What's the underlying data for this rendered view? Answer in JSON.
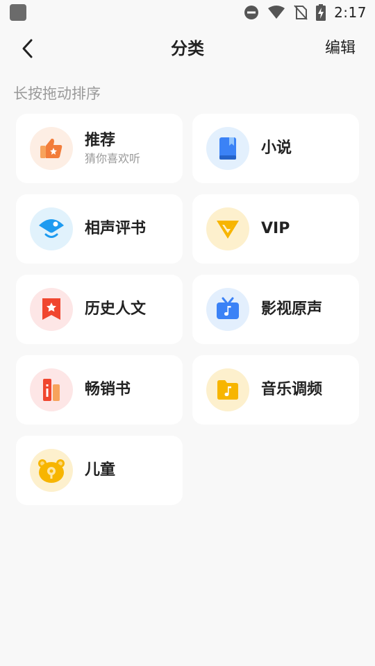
{
  "status_bar": {
    "time": "2:17",
    "icons": [
      "app-notification-icon",
      "do-not-disturb-icon",
      "wifi-icon",
      "no-sim-icon",
      "battery-charging-icon"
    ]
  },
  "nav": {
    "back_icon": "chevron-left-icon",
    "title": "分类",
    "edit_label": "编辑"
  },
  "hint": "长按拖动排序",
  "categories": [
    {
      "name": "推荐",
      "subtitle": "猜你喜欢听",
      "icon": "thumbs-up-star-icon",
      "icon_bg": "#fdeee4"
    },
    {
      "name": "小说",
      "subtitle": "",
      "icon": "book-icon",
      "icon_bg": "#e3f0fd"
    },
    {
      "name": "相声评书",
      "subtitle": "",
      "icon": "fan-icon",
      "icon_bg": "#e1f2fc"
    },
    {
      "name": "VIP",
      "subtitle": "",
      "icon": "vip-diamond-icon",
      "icon_bg": "#fdf0cd"
    },
    {
      "name": "历史人文",
      "subtitle": "",
      "icon": "history-badge-icon",
      "icon_bg": "#fde6e6"
    },
    {
      "name": "影视原声",
      "subtitle": "",
      "icon": "tv-music-icon",
      "icon_bg": "#e3effd"
    },
    {
      "name": "畅销书",
      "subtitle": "",
      "icon": "books-icon",
      "icon_bg": "#fde6e6"
    },
    {
      "name": "音乐调频",
      "subtitle": "",
      "icon": "music-folder-icon",
      "icon_bg": "#fdf0cd"
    },
    {
      "name": "儿童",
      "subtitle": "",
      "icon": "bear-icon",
      "icon_bg": "#fdf0cd"
    }
  ],
  "colors": {
    "background": "#f8f8f8",
    "card": "#ffffff",
    "title_text": "#222222",
    "hint_text": "#9a9a9a"
  }
}
